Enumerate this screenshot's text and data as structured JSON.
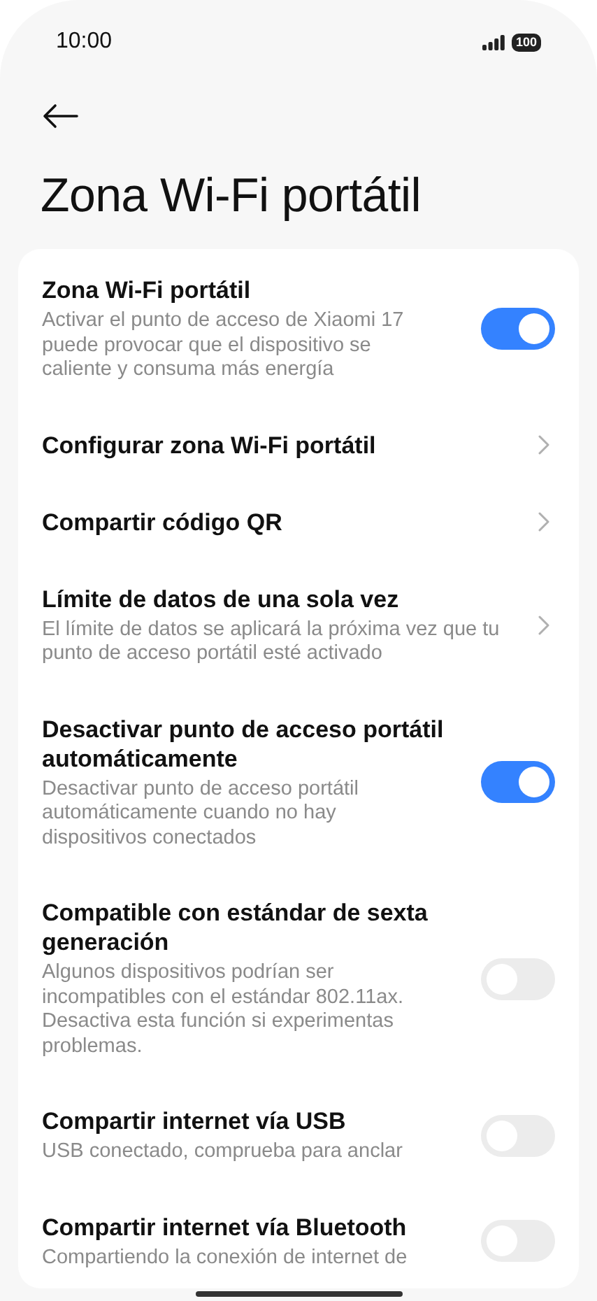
{
  "status_bar": {
    "time": "10:00",
    "battery": "100"
  },
  "title": "Zona Wi-Fi portátil",
  "items": [
    {
      "kind": "toggle",
      "title": "Zona Wi-Fi portátil",
      "subtitle": "Activar el punto de acceso de Xiaomi 17 puede provocar que el dispositivo se caliente y consuma más energía",
      "on": true
    },
    {
      "kind": "link",
      "title": "Configurar zona Wi-Fi portátil"
    },
    {
      "kind": "link",
      "title": "Compartir código QR"
    },
    {
      "kind": "link",
      "title": "Límite de datos de una sola vez",
      "subtitle": "El límite de datos se aplicará la próxima vez que tu punto de acceso portátil esté activado"
    },
    {
      "kind": "toggle",
      "title": "Desactivar punto de acceso portátil automáticamente",
      "subtitle": "Desactivar punto de acceso portátil automáticamente cuando no hay dispositivos conectados",
      "on": true
    },
    {
      "kind": "toggle",
      "title": "Compatible con estándar de sexta generación",
      "subtitle": "Algunos dispositivos podrían ser incompatibles con el estándar 802.11ax. Desactiva esta función si experimentas problemas.",
      "on": false
    },
    {
      "kind": "toggle",
      "title": "Compartir internet vía USB",
      "subtitle": "USB conectado, comprueba para anclar",
      "on": false
    },
    {
      "kind": "toggle",
      "title": "Compartir internet vía Bluetooth",
      "subtitle": "Compartiendo la conexión de internet de",
      "on": false
    }
  ]
}
